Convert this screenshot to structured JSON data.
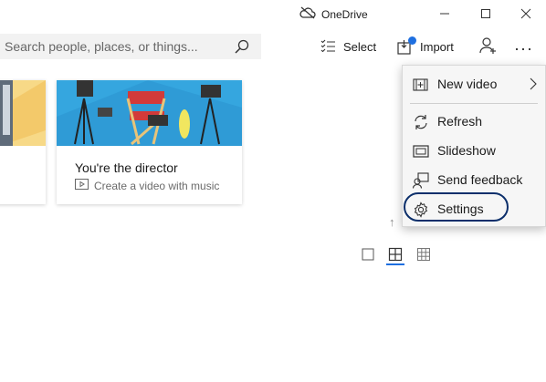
{
  "titlebar": {
    "app_label": "OneDrive"
  },
  "search": {
    "placeholder": "Search people, places, or things..."
  },
  "toolbar": {
    "select_label": "Select",
    "import_label": "Import"
  },
  "cards": [
    {
      "title": "You're the director",
      "subtitle": "Create a video with music"
    }
  ],
  "menu": {
    "items": [
      {
        "label": "New video",
        "icon": "new-video-icon",
        "has_submenu": true
      },
      {
        "label": "Refresh",
        "icon": "refresh-icon"
      },
      {
        "label": "Slideshow",
        "icon": "slideshow-icon"
      },
      {
        "label": "Send feedback",
        "icon": "feedback-icon"
      },
      {
        "label": "Settings",
        "icon": "gear-icon"
      }
    ]
  },
  "colors": {
    "accent": "#1e6fe0",
    "highlight_ring": "#0c2f6b",
    "menu_bg": "#f6f6f6"
  }
}
